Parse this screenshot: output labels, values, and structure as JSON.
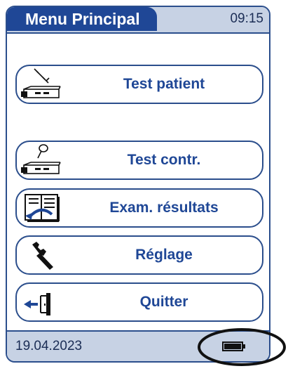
{
  "header": {
    "title": "Menu Principal",
    "time": "09:15"
  },
  "menu": {
    "items": [
      {
        "label": "Test patient",
        "icon": "patient-test-strip-icon"
      },
      {
        "label": "Test contr.",
        "icon": "control-test-strip-icon"
      },
      {
        "label": "Exam. résultats",
        "icon": "memory-results-icon"
      },
      {
        "label": "Réglage",
        "icon": "wrench-icon"
      },
      {
        "label": "Quitter",
        "icon": "exit-door-icon"
      }
    ]
  },
  "footer": {
    "date": "19.04.2023",
    "battery_icon": "battery-full-icon",
    "battery_level": 1.0
  },
  "colors": {
    "accent": "#1f4796",
    "bar": "#c7d2e4",
    "border": "#2b4e8c"
  }
}
